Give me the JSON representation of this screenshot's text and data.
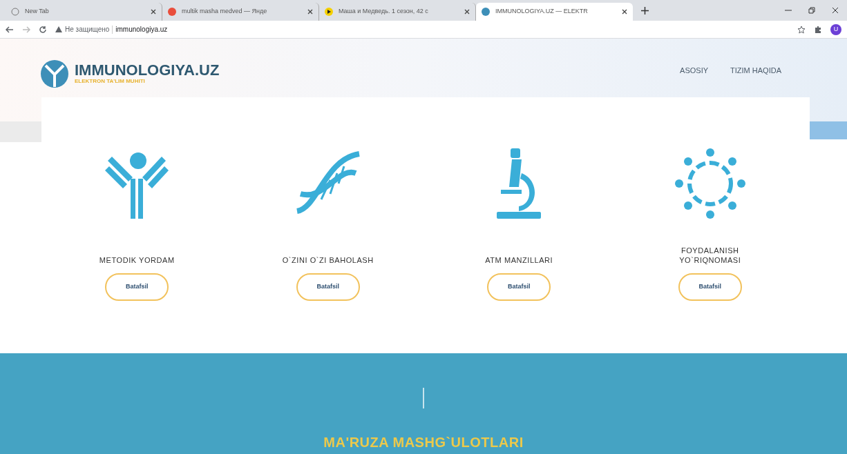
{
  "browser": {
    "tabs": [
      {
        "title": "New Tab",
        "selected": false
      },
      {
        "title": "multik masha medved — Янде",
        "selected": false
      },
      {
        "title": "Маша и Медведь. 1 сезон, 42 с",
        "selected": false
      },
      {
        "title": "IMMUNOLOGIYA.UZ — ELEKTR",
        "selected": true
      }
    ],
    "security": "Не защищено",
    "url": "immunologiya.uz",
    "profile": "U"
  },
  "site": {
    "logo": "IMMUNOLOGIYA.UZ",
    "tagline": "ELEKTRON TA'LIM MUHITI",
    "nav": [
      {
        "label": "ASOSIY"
      },
      {
        "label": "TIZIM HAQIDA"
      }
    ]
  },
  "features": [
    {
      "kind": "antibody",
      "title": "METODIK YORDAM",
      "button": "Batafsil"
    },
    {
      "kind": "dna",
      "title": "O`ZINI O`ZI BAHOLASH",
      "button": "Batafsil"
    },
    {
      "kind": "microscope",
      "title": "ATM MANZILLARI",
      "button": "Batafsil"
    },
    {
      "kind": "virus",
      "title": "FOYDALANISH YO`RIQNOMASI",
      "button": "Batafsil"
    }
  ],
  "section": {
    "title": "MA'RUZA MASHG`ULOTLARI"
  }
}
